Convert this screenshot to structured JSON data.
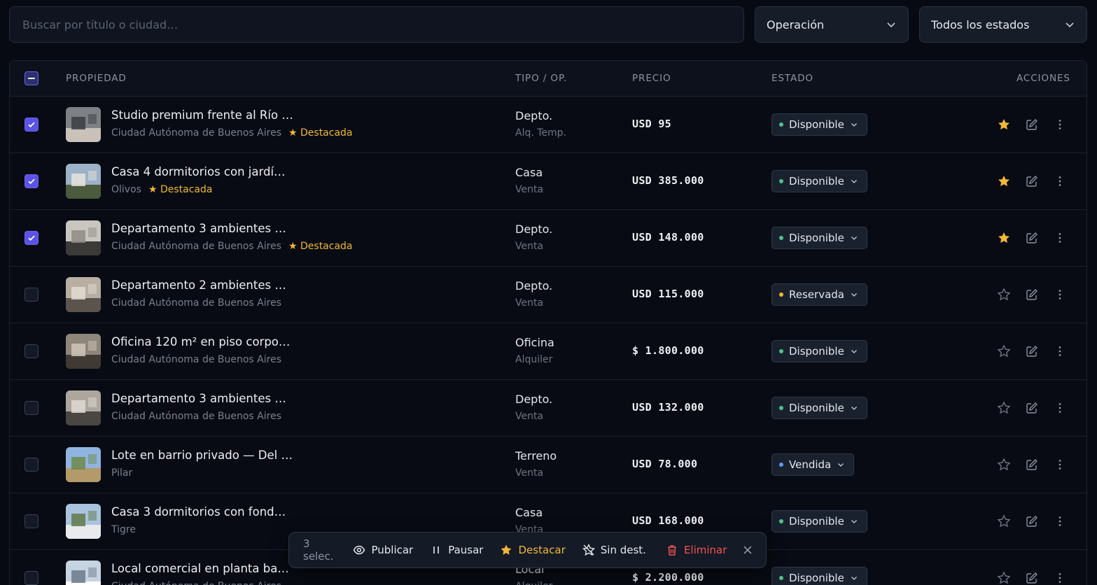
{
  "search": {
    "placeholder": "Buscar por título o ciudad…"
  },
  "filters": {
    "operation": "Operación",
    "status": "Todos los estados"
  },
  "table": {
    "headers": {
      "property": "PROPIEDAD",
      "type": "TIPO / OP.",
      "price": "PRECIO",
      "status": "ESTADO",
      "actions": "ACCIONES"
    },
    "featured_label": "★ Destacada",
    "rows": [
      {
        "title": "Studio premium frente al Río …",
        "city": "Ciudad Autónoma de Buenos Aires",
        "featured": true,
        "type": "Depto.",
        "operation": "Alq. Temp.",
        "price": "USD 95",
        "status": "Disponible",
        "status_color": "#4ec48a",
        "selected": true
      },
      {
        "title": "Casa 4 dormitorios con jardí…",
        "city": "Olivos",
        "featured": true,
        "type": "Casa",
        "operation": "Venta",
        "price": "USD 385.000",
        "status": "Disponible",
        "status_color": "#4ec48a",
        "selected": true
      },
      {
        "title": "Departamento 3 ambientes …",
        "city": "Ciudad Autónoma de Buenos Aires",
        "featured": true,
        "type": "Depto.",
        "operation": "Venta",
        "price": "USD 148.000",
        "status": "Disponible",
        "status_color": "#4ec48a",
        "selected": true
      },
      {
        "title": "Departamento 2 ambientes …",
        "city": "Ciudad Autónoma de Buenos Aires",
        "featured": false,
        "type": "Depto.",
        "operation": "Venta",
        "price": "USD 115.000",
        "status": "Reservada",
        "status_color": "#f2b735",
        "selected": false
      },
      {
        "title": "Oficina 120 m² en piso corpo…",
        "city": "Ciudad Autónoma de Buenos Aires",
        "featured": false,
        "type": "Oficina",
        "operation": "Alquiler",
        "price": "$ 1.800.000",
        "status": "Disponible",
        "status_color": "#4ec48a",
        "selected": false
      },
      {
        "title": "Departamento 3 ambientes …",
        "city": "Ciudad Autónoma de Buenos Aires",
        "featured": false,
        "type": "Depto.",
        "operation": "Venta",
        "price": "USD 132.000",
        "status": "Disponible",
        "status_color": "#4ec48a",
        "selected": false
      },
      {
        "title": "Lote en barrio privado — Del …",
        "city": "Pilar",
        "featured": false,
        "type": "Terreno",
        "operation": "Venta",
        "price": "USD 78.000",
        "status": "Vendida",
        "status_color": "#5b9bf0",
        "selected": false
      },
      {
        "title": "Casa 3 dormitorios con fond…",
        "city": "Tigre",
        "featured": false,
        "type": "Casa",
        "operation": "Venta",
        "price": "USD 168.000",
        "status": "Disponible",
        "status_color": "#4ec48a",
        "selected": false
      },
      {
        "title": "Local comercial en planta ba…",
        "city": "Ciudad Autónoma de Buenos Aires",
        "featured": false,
        "type": "Local",
        "operation": "Alquiler",
        "price": "$ 2.200.000",
        "status": "Disponible",
        "status_color": "#4ec48a",
        "selected": false
      }
    ]
  },
  "bulk_bar": {
    "count": "3 selec.",
    "publish": "Publicar",
    "pause": "Pausar",
    "feature": "Destacar",
    "unfeature": "Sin dest.",
    "delete": "Eliminar"
  },
  "colors": {
    "accent": "#5b52e8",
    "featured": "#f2b735",
    "danger": "#ef5350"
  }
}
